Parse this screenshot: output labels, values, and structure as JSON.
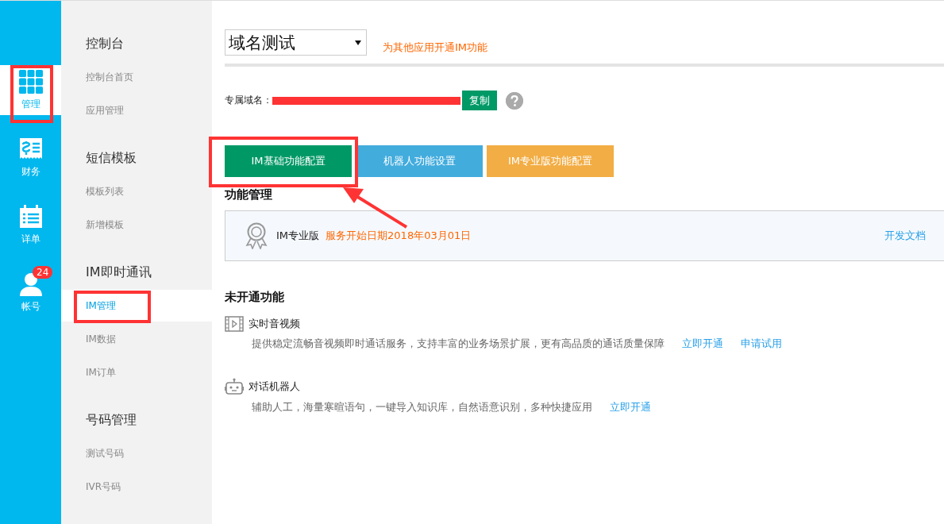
{
  "rail": [
    {
      "label": "管理",
      "selected": true
    },
    {
      "label": "财务",
      "selected": false
    },
    {
      "label": "详单",
      "selected": false
    },
    {
      "label": "帐号",
      "selected": false,
      "badge": "24"
    }
  ],
  "sidebar": {
    "groups": [
      {
        "title": "控制台",
        "items": [
          {
            "label": "控制台首页",
            "selected": false
          },
          {
            "label": "应用管理",
            "selected": false
          }
        ]
      },
      {
        "title": "短信模板",
        "items": [
          {
            "label": "模板列表",
            "selected": false
          },
          {
            "label": "新增模板",
            "selected": false
          }
        ]
      },
      {
        "title": "IM即时通讯",
        "items": [
          {
            "label": "IM管理",
            "selected": true
          },
          {
            "label": "IM数据",
            "selected": false
          },
          {
            "label": "IM订单",
            "selected": false
          }
        ]
      },
      {
        "title": "号码管理",
        "items": [
          {
            "label": "测试号码",
            "selected": false
          },
          {
            "label": "IVR号码",
            "selected": false
          }
        ]
      }
    ]
  },
  "app_select": {
    "value": "域名测试"
  },
  "open_im_link": "为其他应用开通IM功能",
  "domain": {
    "label": "专属域名：",
    "copy_button": "复制"
  },
  "config_buttons": [
    {
      "label": "IM基础功能配置",
      "color": "#009966"
    },
    {
      "label": "机器人功能设置",
      "color": "#42acdd"
    },
    {
      "label": "IM专业版功能配置",
      "color": "#f2ad44"
    }
  ],
  "feature_section": {
    "title": "功能管理",
    "edition": "IM专业版",
    "service_date": "服务开始日期2018年03月01日",
    "doc_link": "开发文档"
  },
  "inactive_section": {
    "title": "未开通功能",
    "items": [
      {
        "kind": "video",
        "name": "实时音视频",
        "description": "提供稳定流畅音视频即时通话服务，支持丰富的业务场景扩展，更有高品质的通话质量保障",
        "links": [
          "立即开通",
          "申请试用"
        ]
      },
      {
        "kind": "robot",
        "name": "对话机器人",
        "description": "辅助人工，海量寒暄语句，一键导入知识库，自然语意识别，多种快捷应用",
        "links": [
          "立即开通"
        ]
      }
    ]
  }
}
